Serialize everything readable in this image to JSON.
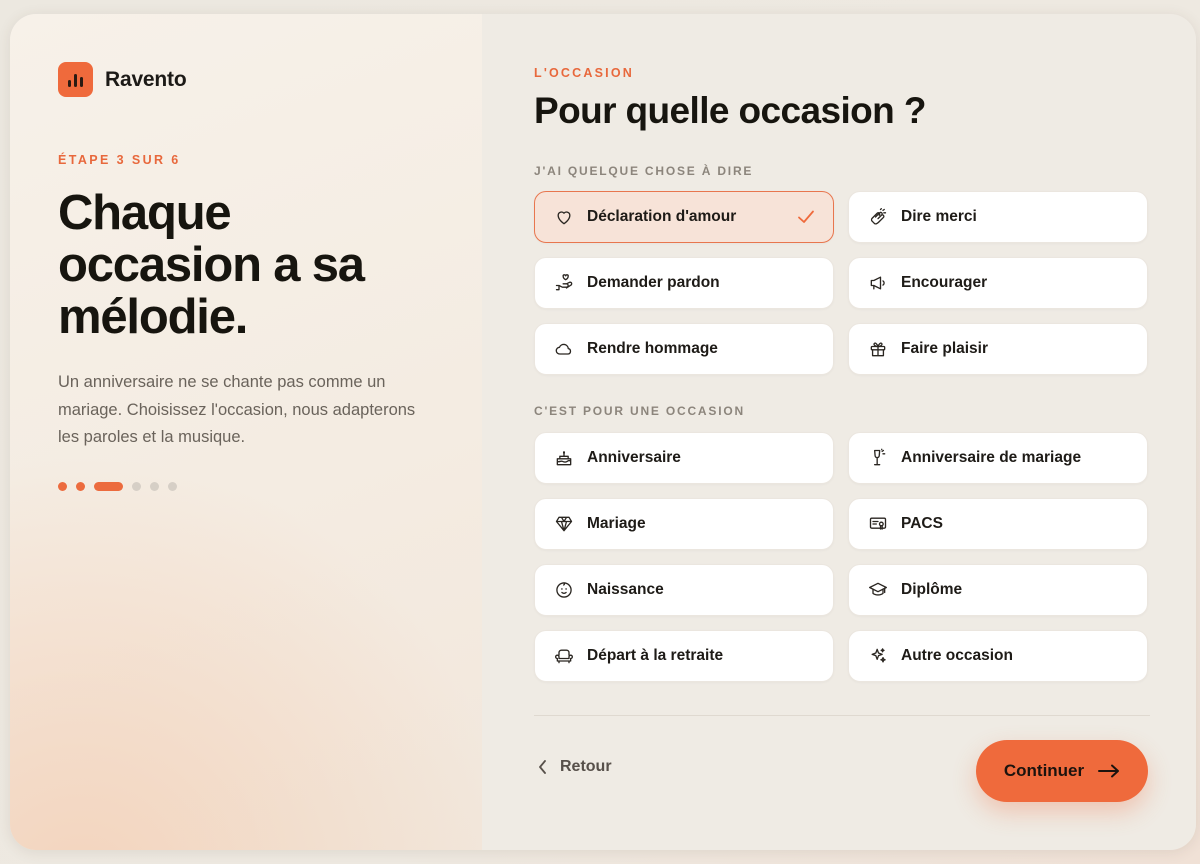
{
  "brand": {
    "name": "Ravento"
  },
  "left": {
    "step_label": "ÉTAPE 3 SUR 6",
    "title": "Chaque occasion a sa mélodie.",
    "description": "Un anniversaire ne se chante pas comme un mariage. Choisissez l'occasion, nous adapterons les paroles et la musique.",
    "progress": {
      "current_step": 3,
      "total_steps": 6
    }
  },
  "right": {
    "eyebrow": "L'OCCASION",
    "title": "Pour quelle occasion ?",
    "group1": {
      "label": "J'AI QUELQUE CHOSE À DIRE",
      "options": [
        {
          "label": "Déclaration d'amour",
          "icon": "heart-icon",
          "selected": true
        },
        {
          "label": "Dire merci",
          "icon": "clapping-hands-icon",
          "selected": false
        },
        {
          "label": "Demander pardon",
          "icon": "hand-heart-icon",
          "selected": false
        },
        {
          "label": "Encourager",
          "icon": "megaphone-icon",
          "selected": false
        },
        {
          "label": "Rendre hommage",
          "icon": "cloud-icon",
          "selected": false
        },
        {
          "label": "Faire plaisir",
          "icon": "gift-icon",
          "selected": false
        }
      ]
    },
    "group2": {
      "label": "C'EST POUR UNE OCCASION",
      "options": [
        {
          "label": "Anniversaire",
          "icon": "cake-icon",
          "selected": false
        },
        {
          "label": "Anniversaire de mariage",
          "icon": "champagne-icon",
          "selected": false
        },
        {
          "label": "Mariage",
          "icon": "diamond-icon",
          "selected": false
        },
        {
          "label": "PACS",
          "icon": "certificate-icon",
          "selected": false
        },
        {
          "label": "Naissance",
          "icon": "baby-icon",
          "selected": false
        },
        {
          "label": "Diplôme",
          "icon": "graduation-cap-icon",
          "selected": false
        },
        {
          "label": "Départ à la retraite",
          "icon": "armchair-icon",
          "selected": false
        },
        {
          "label": "Autre occasion",
          "icon": "sparkles-icon",
          "selected": false
        }
      ]
    },
    "nav": {
      "back_label": "Retour",
      "continue_label": "Continuer"
    }
  },
  "colors": {
    "accent": "#ef6a3c",
    "selected_bg": "#f7e3d8",
    "selected_border": "#e8764e"
  }
}
